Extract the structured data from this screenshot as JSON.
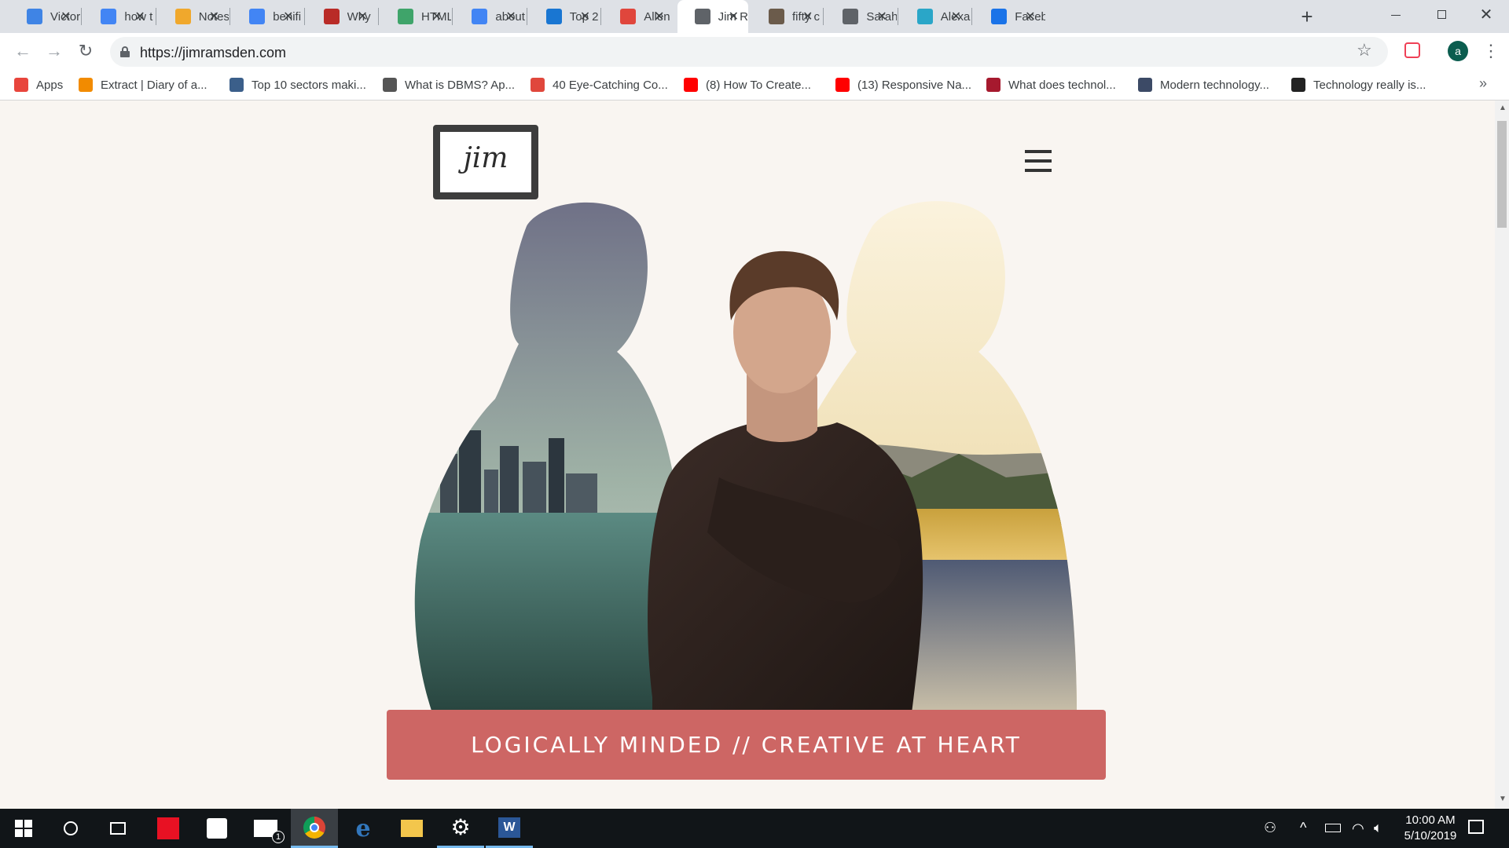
{
  "browser": {
    "tabs": [
      {
        "label": "Victor",
        "favicon": "arrow-icon",
        "color": "#3f84e5"
      },
      {
        "label": "how t",
        "favicon": "google-icon",
        "color": "#4285f4"
      },
      {
        "label": "Notes",
        "favicon": "notes-icon",
        "color": "#f0a82c"
      },
      {
        "label": "benifi",
        "favicon": "google-icon",
        "color": "#4285f4"
      },
      {
        "label": "Why",
        "favicon": "quora-icon",
        "color": "#b92b27"
      },
      {
        "label": "HTML",
        "favicon": "html-icon",
        "color": "#3fa46a"
      },
      {
        "label": "about",
        "favicon": "google-icon",
        "color": "#4285f4"
      },
      {
        "label": "Top 2",
        "favicon": "y-icon",
        "color": "#1976d2"
      },
      {
        "label": "Allen",
        "favicon": "diamond-icon",
        "color": "#e0463c"
      },
      {
        "label": "Jim R",
        "favicon": "globe-icon",
        "color": "#5f6368",
        "active": true
      },
      {
        "label": "fifty c",
        "favicon": "photo-icon",
        "color": "#6b5b4b"
      },
      {
        "label": "Sarah",
        "favicon": "globe-icon",
        "color": "#5f6368"
      },
      {
        "label": "Alexa",
        "favicon": "m-icon",
        "color": "#2aa6c8"
      },
      {
        "label": "Faceb",
        "favicon": "loading-icon",
        "color": "#1a73e8"
      }
    ],
    "new_tab": "+",
    "url": "https://jimramsden.com",
    "profile_initial": "a",
    "bookmarks": [
      {
        "label": "Apps",
        "icon": "apps-icon",
        "color": "#e8453c"
      },
      {
        "label": "Extract | Diary of a...",
        "icon": "penguin-icon",
        "color": "#f28b00"
      },
      {
        "label": "Top 10 sectors maki...",
        "icon": "doc-icon",
        "color": "#3b5f8a"
      },
      {
        "label": "What is DBMS? Ap...",
        "icon": "g-icon",
        "color": "#555555"
      },
      {
        "label": "40 Eye-Catching Co...",
        "icon": "hubspot-icon",
        "color": "#e0473c"
      },
      {
        "label": "(8) How To Create...",
        "icon": "youtube-icon",
        "color": "#ff0000"
      },
      {
        "label": "(13) Responsive Na...",
        "icon": "youtube-icon",
        "color": "#ff0000"
      },
      {
        "label": "What does technol...",
        "icon": "d-icon",
        "color": "#a6192e"
      },
      {
        "label": "Modern technology...",
        "icon": "ia-icon",
        "color": "#3c4a66"
      },
      {
        "label": "Technology really is...",
        "icon": "s-icon",
        "color": "#222222"
      }
    ],
    "overflow": "»"
  },
  "page": {
    "logo_text": "jim",
    "banner_text": "LOGICALLY MINDED // CREATIVE AT HEART",
    "accent_color": "#cd6664",
    "background_color": "#f9f5f1"
  },
  "taskbar": {
    "time": "10:00 AM",
    "date": "5/10/2019",
    "mail_badge": "1"
  }
}
